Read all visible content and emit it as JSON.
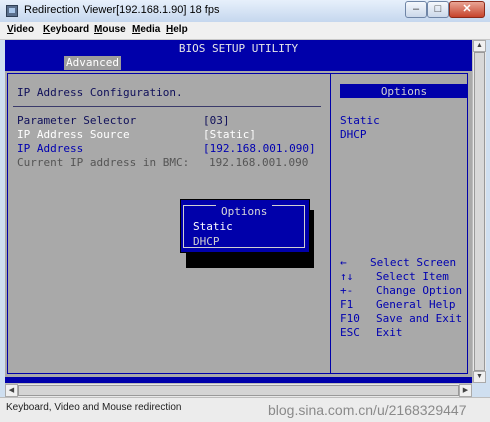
{
  "window": {
    "title": "Redirection Viewer[192.168.1.90]   18 fps",
    "minimize": "–",
    "maximize": "□",
    "close": "✕"
  },
  "menu": [
    {
      "label": "Video",
      "u": "V",
      "rest": "ideo"
    },
    {
      "label": "Keyboard",
      "u": "K",
      "rest": "eyboard"
    },
    {
      "label": "Mouse",
      "u": "M",
      "rest": "ouse"
    },
    {
      "label": "Media",
      "u": "M",
      "rest": "edia"
    },
    {
      "label": "Help",
      "u": "H",
      "rest": "elp"
    }
  ],
  "bios": {
    "title": "BIOS SETUP UTILITY",
    "tab": "Advanced",
    "section_title": "IP Address Configuration.",
    "rows": [
      {
        "label": "Parameter Selector",
        "value": "[03]"
      },
      {
        "label": "IP Address Source",
        "value": "[Static]"
      },
      {
        "label": "IP Address",
        "value": "[192.168.001.090]"
      },
      {
        "label": "Current IP address in BMC:",
        "value": "192.168.001.090"
      }
    ],
    "options_header": "Options",
    "options_list": [
      "Static",
      "DHCP"
    ],
    "help": [
      {
        "key": "←",
        "desc": "Select Screen"
      },
      {
        "key": "↑↓",
        "desc": "Select Item"
      },
      {
        "key": "+-",
        "desc": "Change Option"
      },
      {
        "key": "F1",
        "desc": "General Help"
      },
      {
        "key": "F10",
        "desc": "Save and Exit"
      },
      {
        "key": "ESC",
        "desc": "Exit"
      }
    ],
    "popup": {
      "title": "Options",
      "items": [
        "Static",
        "DHCP"
      ],
      "selected": "Static"
    }
  },
  "status_bar": {
    "text": "Keyboard, Video and Mouse redirection"
  },
  "watermark": "blog.sina.com.cn/u/2168329447",
  "colors": {
    "bios_blue": "#0000aa",
    "panel_grey": "#a9a9a9"
  }
}
